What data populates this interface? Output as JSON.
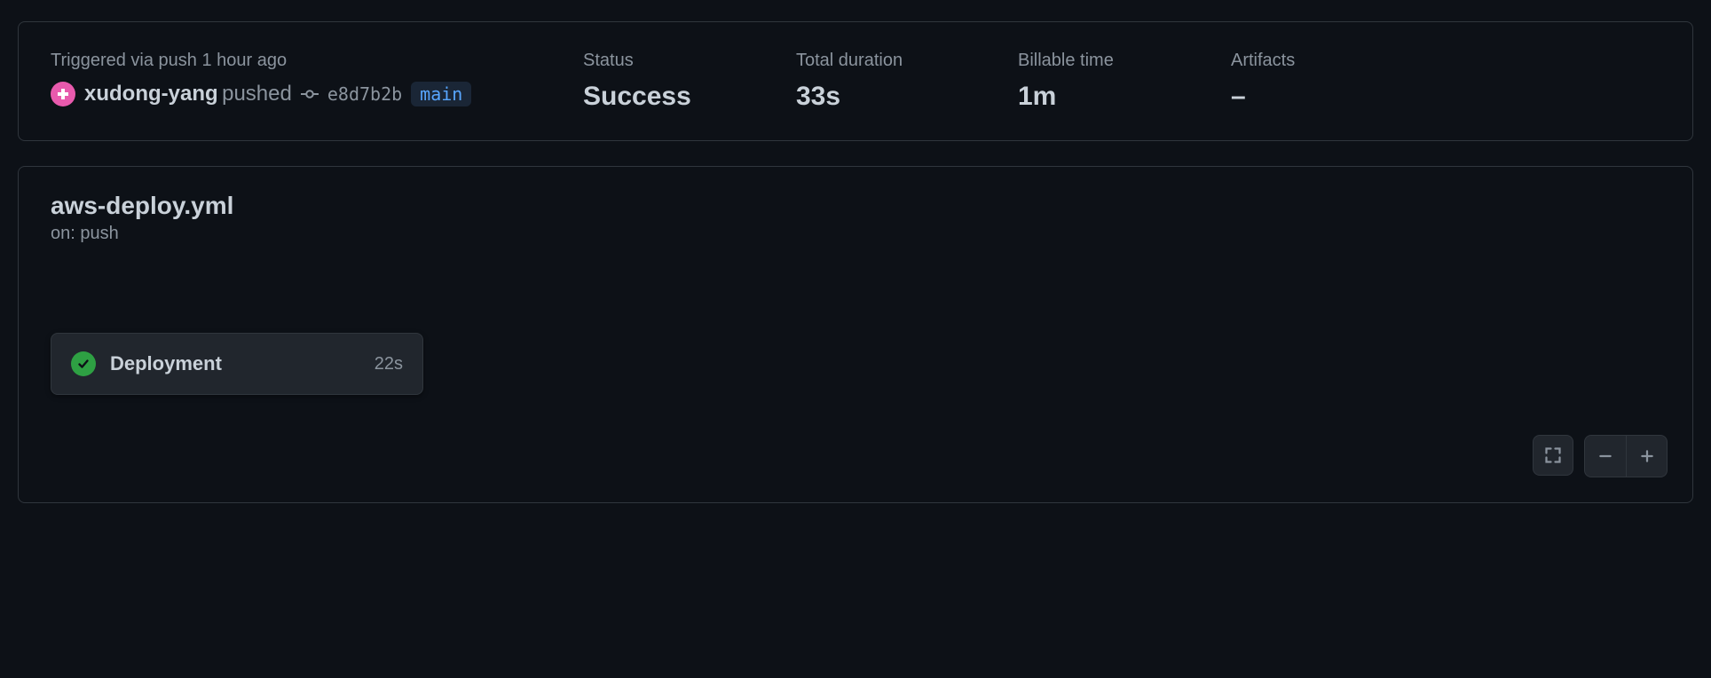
{
  "trigger": {
    "label": "Triggered via push 1 hour ago",
    "username": "xudong-yang",
    "action_word": "pushed",
    "commit_sha": "e8d7b2b",
    "branch": "main"
  },
  "summary": {
    "status_label": "Status",
    "status_value": "Success",
    "duration_label": "Total duration",
    "duration_value": "33s",
    "billable_label": "Billable time",
    "billable_value": "1m",
    "artifacts_label": "Artifacts",
    "artifacts_value": "–"
  },
  "workflow": {
    "file": "aws-deploy.yml",
    "event_line": "on: push",
    "jobs": [
      {
        "name": "Deployment",
        "duration": "22s",
        "status": "success"
      }
    ]
  }
}
